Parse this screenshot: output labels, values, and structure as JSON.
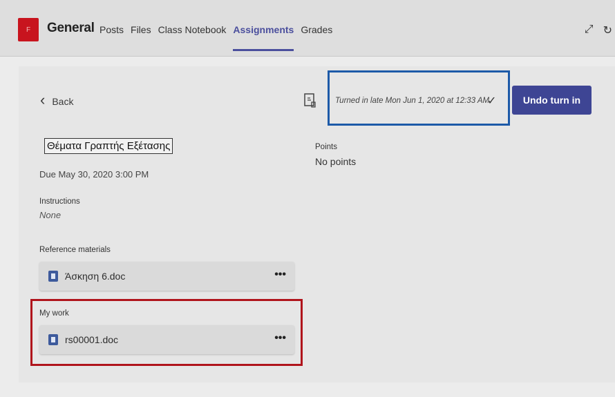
{
  "header": {
    "logo_letter": "F",
    "channel": "General",
    "tabs": [
      {
        "label": "Posts"
      },
      {
        "label": "Files"
      },
      {
        "label": "Class Notebook"
      },
      {
        "label": "Assignments",
        "active": true
      },
      {
        "label": "Grades"
      }
    ],
    "icons": [
      "expand-icon",
      "refresh-icon"
    ]
  },
  "assignment": {
    "back_label": "Back",
    "title": "Θέματα Γραπτής Εξέτασης",
    "due": "Due May 30, 2020 3:00 PM",
    "instructions_label": "Instructions",
    "instructions_value": "None",
    "reference_label": "Reference materials",
    "reference_files": [
      {
        "name": "Άσκηση 6.doc"
      }
    ],
    "my_work_label": "My work",
    "my_work_files": [
      {
        "name": "rs00001.doc"
      }
    ],
    "status": "Turned in late Mon Jun 1, 2020 at 12:33 AM",
    "undo_label": "Undo turn in",
    "points_label": "Points",
    "points_value": "No points"
  },
  "colors": {
    "accent": "#3e4594",
    "logo": "#c8141e",
    "highlight_red": "#b0141c",
    "highlight_blue": "#1d5aa8"
  }
}
